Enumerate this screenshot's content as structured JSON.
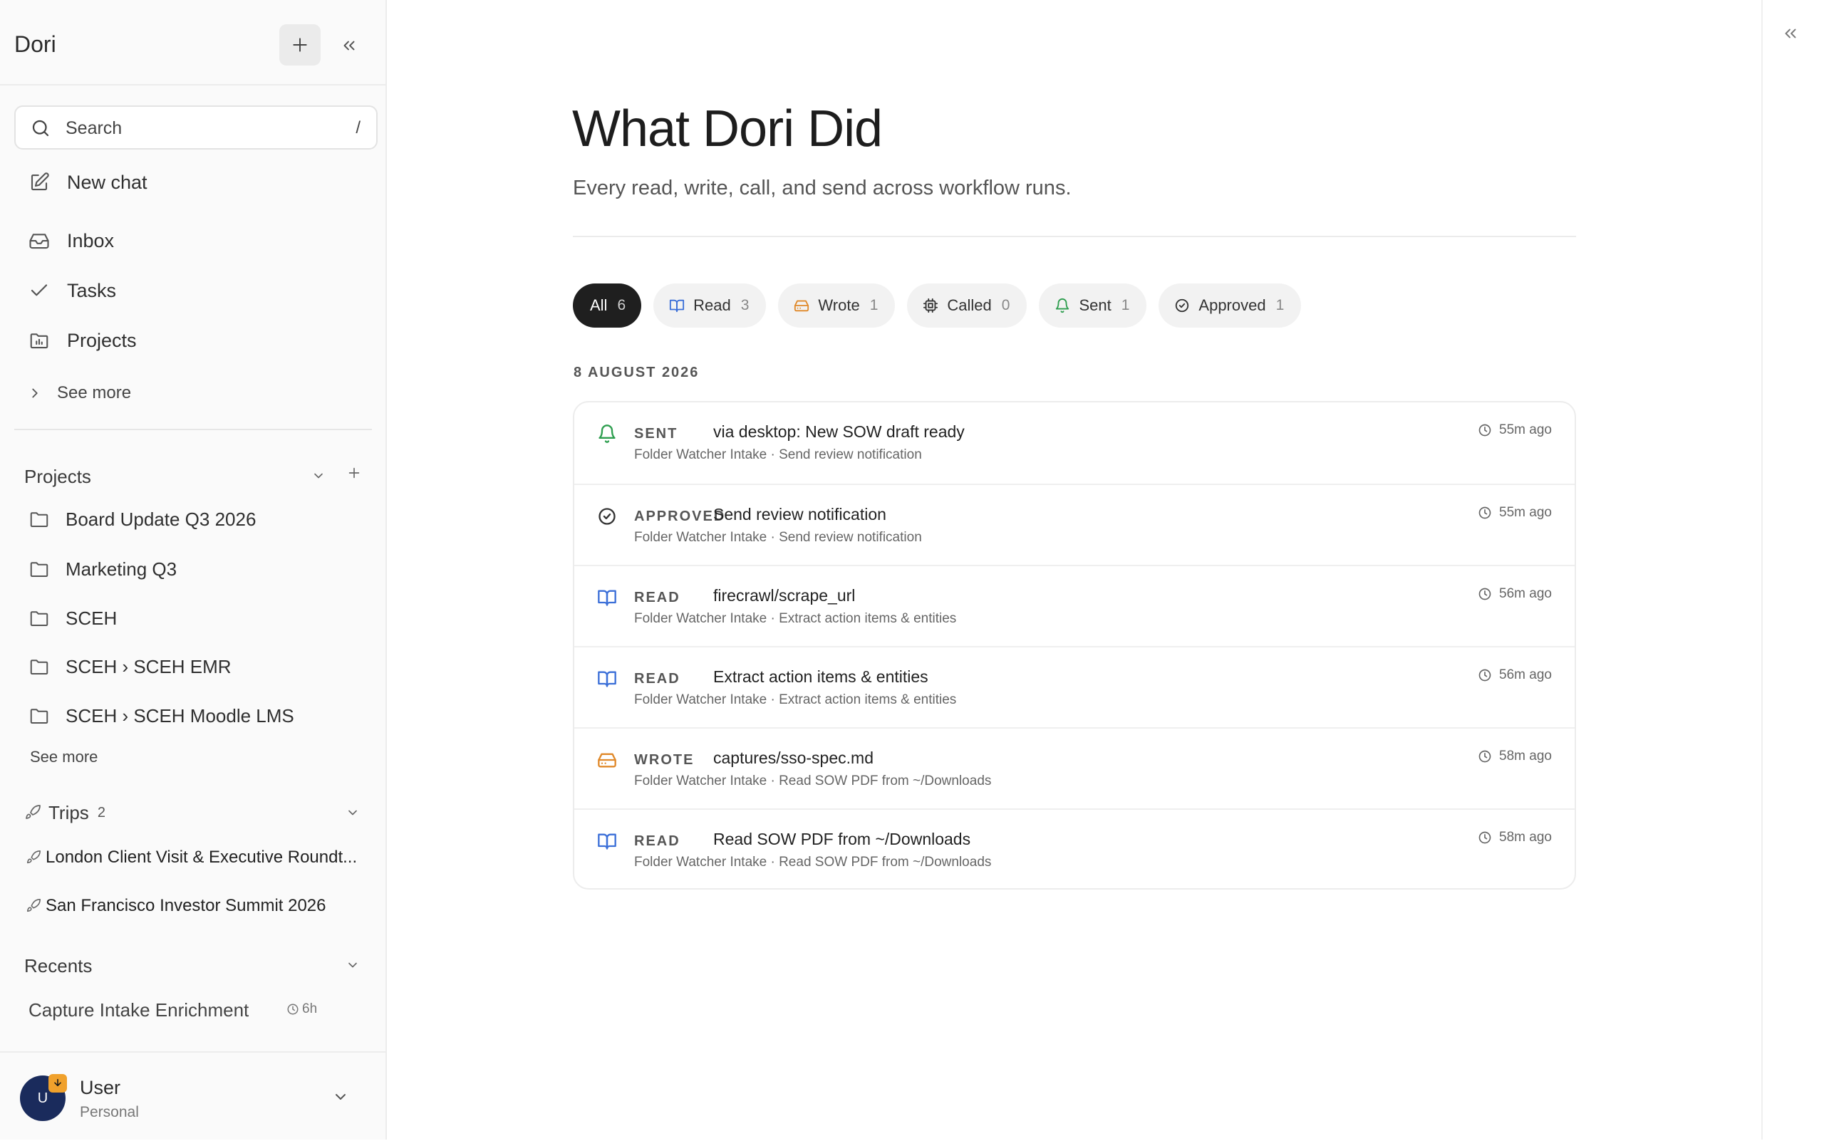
{
  "sidebar": {
    "app_name": "Dori",
    "search": {
      "placeholder": "Search",
      "shortcut": "/"
    },
    "nav": [
      {
        "label": "New chat",
        "icon": "edit-icon"
      },
      {
        "label": "Inbox",
        "icon": "inbox-icon"
      },
      {
        "label": "Tasks",
        "icon": "check-icon"
      },
      {
        "label": "Projects",
        "icon": "folder-chart-icon"
      }
    ],
    "see_more": "See more",
    "projects": {
      "title": "Projects",
      "items": [
        "Board Update Q3 2026",
        "Marketing Q3",
        "SCEH",
        "SCEH › SCEH EMR",
        "SCEH › SCEH Moodle LMS"
      ],
      "see_more": "See more"
    },
    "trips": {
      "title": "Trips",
      "count": "2",
      "items": [
        "London Client Visit & Executive Roundt...",
        "San Francisco Investor Summit 2026"
      ]
    },
    "recents": {
      "title": "Recents",
      "items": [
        {
          "label": "Capture Intake Enrichment",
          "time": "6h"
        }
      ]
    },
    "user": {
      "initial": "U",
      "name": "User",
      "plan": "Personal"
    }
  },
  "main": {
    "title": "What Dori Did",
    "subtitle": "Every read, write, call, and send across workflow runs.",
    "filters": [
      {
        "label": "All",
        "count": "6",
        "icon": "",
        "active": true
      },
      {
        "label": "Read",
        "count": "3",
        "icon": "book-icon"
      },
      {
        "label": "Wrote",
        "count": "1",
        "icon": "drive-icon"
      },
      {
        "label": "Called",
        "count": "0",
        "icon": "chip-icon"
      },
      {
        "label": "Sent",
        "count": "1",
        "icon": "bell-icon"
      },
      {
        "label": "Approved",
        "count": "1",
        "icon": "check-circle-icon"
      }
    ],
    "date_heading": "8 AUGUST 2026",
    "activities": [
      {
        "kind": "SENT",
        "icon": "bell-icon",
        "title": "via desktop: New SOW draft ready",
        "subtitle": "Folder Watcher Intake · Send review notification",
        "time": "55m ago"
      },
      {
        "kind": "APPROVED",
        "icon": "check-circle-icon",
        "title": "Send review notification",
        "subtitle": "Folder Watcher Intake · Send review notification",
        "time": "55m ago"
      },
      {
        "kind": "READ",
        "icon": "book-icon",
        "title": "firecrawl/scrape_url",
        "subtitle": "Folder Watcher Intake · Extract action items & entities",
        "time": "56m ago"
      },
      {
        "kind": "READ",
        "icon": "book-icon",
        "title": "Extract action items & entities",
        "subtitle": "Folder Watcher Intake · Extract action items & entities",
        "time": "56m ago"
      },
      {
        "kind": "WROTE",
        "icon": "drive-icon",
        "title": "captures/sso-spec.md",
        "subtitle": "Folder Watcher Intake · Read SOW PDF from ~/Downloads",
        "time": "58m ago"
      },
      {
        "kind": "READ",
        "icon": "book-icon",
        "title": "Read SOW PDF from ~/Downloads",
        "subtitle": "Folder Watcher Intake · Read SOW PDF from ~/Downloads",
        "time": "58m ago"
      }
    ],
    "colors": {
      "sent": "#2e9e4f",
      "read": "#3b6fd8",
      "wrote": "#e0892a",
      "neutral": "#333333"
    }
  }
}
